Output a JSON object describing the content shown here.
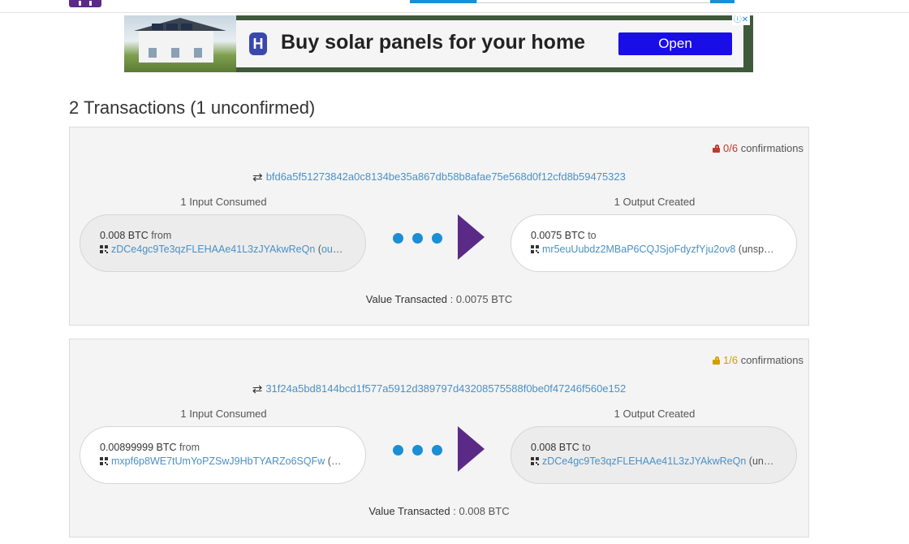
{
  "ad": {
    "headline": "Buy solar panels for your home",
    "cta": "Open",
    "brand_letter": "H",
    "choices_icon": "ad-choices-icon"
  },
  "page_title": "2 Transactions (1 unconfirmed)",
  "transactions": [
    {
      "confirmations_count": "0/6",
      "confirmations_word": "confirmations",
      "confirmations_color": "#c0392b",
      "txid": "bfd6a5f51273842a0c8134be35a867db58b8afae75e568d0f12cfd8b59475323",
      "inputs_label": "1 Input Consumed",
      "outputs_label": "1 Output Created",
      "input": {
        "amount": "0.008 BTC",
        "direction": "from",
        "address": "zDCe4gc9Te3qzFLEHAAe41L3zJYAkwReQn",
        "status_open": "(",
        "status_link": "output",
        "status_close": ")"
      },
      "output": {
        "amount": "0.0075 BTC",
        "direction": "to",
        "address": "mr5euUubdz2MBaP6CQJSjoFdyzfYju2ov8",
        "status": "(unspent)"
      },
      "value_label": "Value Transacted",
      "value_sep": " : ",
      "value": "0.0075 BTC"
    },
    {
      "confirmations_count": "1/6",
      "confirmations_word": "confirmations",
      "confirmations_color": "#d39e00",
      "txid": "31f24a5bd8144bcd1f577a5912d389797d43208575588f0be0f47246f560e152",
      "inputs_label": "1 Input Consumed",
      "outputs_label": "1 Output Created",
      "input": {
        "amount": "0.00899999 BTC",
        "direction": "from",
        "address": "mxpf6p8WE7tUmYoPZSwJ9HbTYARZo6SQFw",
        "status_open": "(",
        "status_link": "out…",
        "status_close": ""
      },
      "output": {
        "amount": "0.008 BTC",
        "direction": "to",
        "address": "zDCe4gc9Te3qzFLEHAAe41L3zJYAkwReQn",
        "status": "(unspent)"
      },
      "value_label": "Value Transacted",
      "value_sep": " : ",
      "value": "0.008 BTC"
    }
  ],
  "colors": {
    "link": "#4a90c7",
    "accent_purple": "#5b2a86",
    "flow_dots": "#1a8fd6"
  }
}
